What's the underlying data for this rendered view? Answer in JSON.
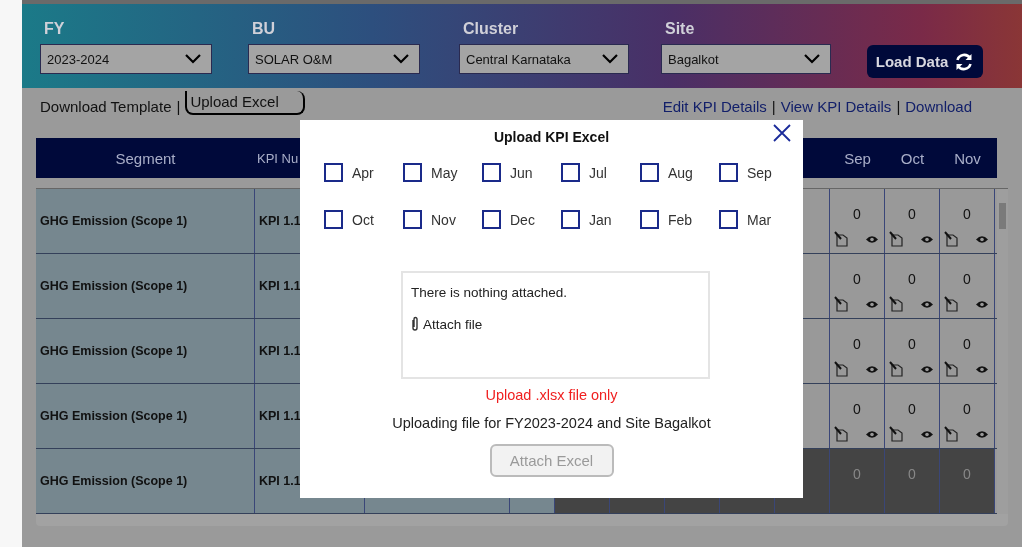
{
  "filters": [
    {
      "label": "FY",
      "value": "2023-2024"
    },
    {
      "label": "BU",
      "value": "SOLAR O&M"
    },
    {
      "label": "Cluster",
      "value": "Central Karnataka"
    },
    {
      "label": "Site",
      "value": "Bagalkot"
    }
  ],
  "load_button": "Load Data",
  "link_separator": "|",
  "left_links": [
    {
      "label": "Download Template",
      "selected": false
    },
    {
      "label": "Upload Excel",
      "selected": true
    }
  ],
  "right_links": [
    "Edit KPI Details",
    "View KPI Details",
    "Download"
  ],
  "table": {
    "columns_left": [
      "Segment",
      "KPI Nu"
    ],
    "columns_right": [
      "Sep",
      "Oct",
      "Nov"
    ],
    "rows": [
      {
        "segment": "GHG Emission (Scope 1)",
        "kpi": "KPI 1.1",
        "values": [
          "0",
          "0",
          "0"
        ],
        "disabled": false
      },
      {
        "segment": "GHG Emission (Scope 1)",
        "kpi": "KPI 1.1",
        "values": [
          "0",
          "0",
          "0"
        ],
        "disabled": false
      },
      {
        "segment": "GHG Emission (Scope 1)",
        "kpi": "KPI 1.1",
        "values": [
          "0",
          "0",
          "0"
        ],
        "disabled": false
      },
      {
        "segment": "GHG Emission (Scope 1)",
        "kpi": "KPI 1.1",
        "values": [
          "0",
          "0",
          "0"
        ],
        "disabled": false
      },
      {
        "segment": "GHG Emission (Scope 1)",
        "kpi": "KPI 1.1",
        "values": [
          "0",
          "0",
          "0"
        ],
        "disabled": true
      }
    ]
  },
  "modal": {
    "title": "Upload KPI Excel",
    "months": [
      {
        "label": "Apr",
        "checked": false
      },
      {
        "label": "May",
        "checked": false
      },
      {
        "label": "Jun",
        "checked": false
      },
      {
        "label": "Jul",
        "checked": false
      },
      {
        "label": "Aug",
        "checked": false
      },
      {
        "label": "Sep",
        "checked": false
      },
      {
        "label": "Oct",
        "checked": false
      },
      {
        "label": "Nov",
        "checked": false
      },
      {
        "label": "Dec",
        "checked": false
      },
      {
        "label": "Jan",
        "checked": false
      },
      {
        "label": "Feb",
        "checked": false
      },
      {
        "label": "Mar",
        "checked": false
      }
    ],
    "attachments_empty": "There is nothing attached.",
    "attach_link": "Attach file",
    "error": "Upload .xlsx file only",
    "info": "Uploading file for FY2023-2024 and Site Bagalkot",
    "button": {
      "label": "Attach Excel",
      "disabled": true
    }
  }
}
